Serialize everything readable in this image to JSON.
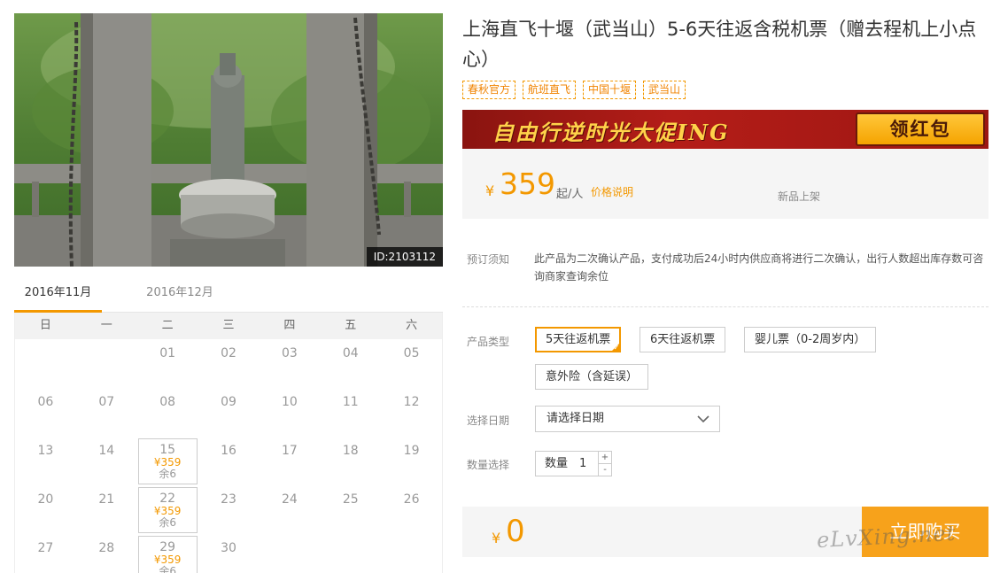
{
  "product": {
    "photo_id": "ID:2103112",
    "title": "上海直飞十堰（武当山）5-6天往返含税机票（赠去程机上小点心）",
    "tags": [
      "春秋官方",
      "航班直飞",
      "中国十堰",
      "武当山"
    ]
  },
  "banner": {
    "text": "自由行逆时光大促ING",
    "button_label": "领红包"
  },
  "price": {
    "currency": "¥",
    "amount": "359",
    "unit": "起/人",
    "note_link": "价格说明",
    "new_badge": "新品上架"
  },
  "booking_notice": {
    "label": "预订须知",
    "text": "此产品为二次确认产品，支付成功后24小时内供应商将进行二次确认，出行人数超出库存数可咨询商家查询余位"
  },
  "product_type": {
    "label": "产品类型",
    "options": [
      "5天往返机票",
      "6天往返机票",
      "婴儿票（0-2周岁内）",
      "意外险（含延误）"
    ],
    "selected_index": 0
  },
  "date_select": {
    "label": "选择日期",
    "placeholder": "请选择日期"
  },
  "quantity": {
    "label": "数量选择",
    "field_label": "数量",
    "value": "1",
    "plus": "+",
    "minus": "-"
  },
  "total": {
    "currency": "¥",
    "amount": "0",
    "buy_label": "立即购买"
  },
  "calendar": {
    "tabs": [
      "2016年11月",
      "2016年12月"
    ],
    "active_tab": 0,
    "weekdays": [
      "日",
      "一",
      "二",
      "三",
      "四",
      "五",
      "六"
    ],
    "weeks": [
      [
        null,
        null,
        {
          "d": "01"
        },
        {
          "d": "02"
        },
        {
          "d": "03"
        },
        {
          "d": "04"
        },
        {
          "d": "05"
        }
      ],
      [
        {
          "d": "06"
        },
        {
          "d": "07"
        },
        {
          "d": "08"
        },
        {
          "d": "09"
        },
        {
          "d": "10"
        },
        {
          "d": "11"
        },
        {
          "d": "12"
        }
      ],
      [
        {
          "d": "13"
        },
        {
          "d": "14"
        },
        {
          "d": "15",
          "p": "¥359",
          "s": "余6"
        },
        {
          "d": "16"
        },
        {
          "d": "17"
        },
        {
          "d": "18"
        },
        {
          "d": "19"
        }
      ],
      [
        {
          "d": "20"
        },
        {
          "d": "21"
        },
        {
          "d": "22",
          "p": "¥359",
          "s": "余6"
        },
        {
          "d": "23"
        },
        {
          "d": "24"
        },
        {
          "d": "25"
        },
        {
          "d": "26"
        }
      ],
      [
        {
          "d": "27"
        },
        {
          "d": "28"
        },
        {
          "d": "29",
          "p": "¥359",
          "s": "余6"
        },
        {
          "d": "30"
        },
        null,
        null,
        null
      ]
    ]
  },
  "watermark": "eLvXing.net",
  "colors": {
    "accent": "#f39800",
    "banner_red": "#b41d18"
  }
}
